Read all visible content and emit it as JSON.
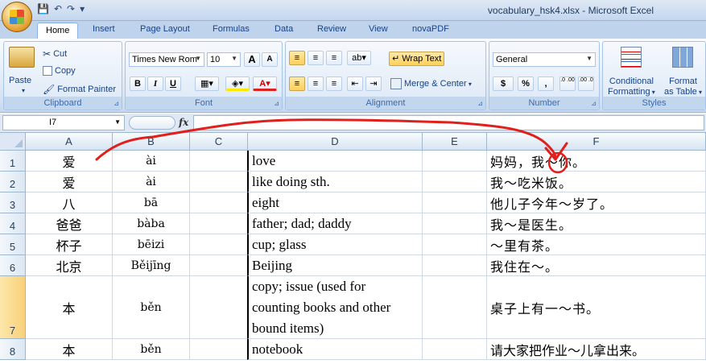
{
  "window": {
    "title": "vocabulary_hsk4.xlsx - Microsoft Excel"
  },
  "ribbon_tabs": [
    "Home",
    "Insert",
    "Page Layout",
    "Formulas",
    "Data",
    "Review",
    "View",
    "novaPDF"
  ],
  "clipboard": {
    "paste": "Paste",
    "cut": "Cut",
    "copy": "Copy",
    "format_painter": "Format Painter",
    "label": "Clipboard"
  },
  "font": {
    "family": "Times New Rom",
    "size": "10",
    "bold": "B",
    "italic": "I",
    "underline": "U",
    "label": "Font"
  },
  "alignment": {
    "wrap_text": "Wrap Text",
    "merge_center": "Merge & Center",
    "label": "Alignment"
  },
  "number": {
    "format": "General",
    "currency": "$",
    "percent": "%",
    "comma": ",",
    "inc_dec": ".0 .00",
    "dec_dec": ".00 .0",
    "label": "Number"
  },
  "styles": {
    "conditional": "Conditional",
    "formatting": "Formatting",
    "format": "Format",
    "as_table": "as Table",
    "label": "Styles"
  },
  "formula_bar": {
    "name_box": "I7",
    "fx": "fx",
    "formula": ""
  },
  "sheet": {
    "columns": [
      "A",
      "B",
      "C",
      "D",
      "E",
      "F"
    ],
    "selected_row": 7,
    "rows": [
      {
        "num": "1",
        "hanzi": "爱",
        "pinyin": "ài",
        "c": "",
        "english": "love",
        "e": "",
        "example": "妈妈，我～你。"
      },
      {
        "num": "2",
        "hanzi": "爱",
        "pinyin": "ài",
        "c": "",
        "english": "like doing sth.",
        "e": "",
        "example": "我～吃米饭。"
      },
      {
        "num": "3",
        "hanzi": "八",
        "pinyin": "bā",
        "c": "",
        "english": "eight",
        "e": "",
        "example": "他儿子今年～岁了。"
      },
      {
        "num": "4",
        "hanzi": "爸爸",
        "pinyin": "bàba",
        "c": "",
        "english": "father; dad; daddy",
        "e": "",
        "example": "我～是医生。"
      },
      {
        "num": "5",
        "hanzi": "杯子",
        "pinyin": "bēizi",
        "c": "",
        "english": "cup; glass",
        "e": "",
        "example": "～里有茶。"
      },
      {
        "num": "6",
        "hanzi": "北京",
        "pinyin": "Běijīng",
        "c": "",
        "english": "Beijing",
        "e": "",
        "example": "我住在～。"
      },
      {
        "num": "7",
        "hanzi": "本",
        "pinyin": "běn",
        "c": "",
        "english": "copy; issue (used for counting books and other bound items)",
        "e": "",
        "example": "桌子上有一～书。"
      },
      {
        "num": "8",
        "hanzi": "本",
        "pinyin": "běn",
        "c": "",
        "english": "notebook",
        "e": "",
        "example": "请大家把作业～儿拿出来。"
      }
    ]
  },
  "colors": {
    "annotation": "#e0201c",
    "selected_row_header": "#f9d07a"
  }
}
